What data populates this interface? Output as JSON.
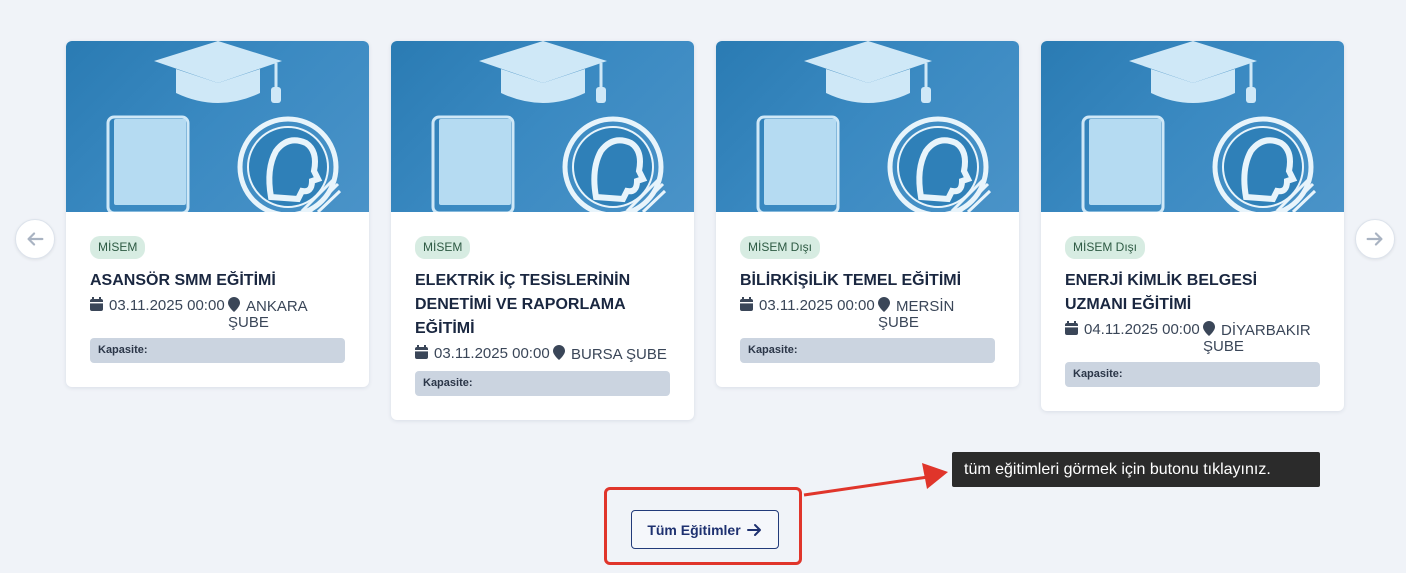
{
  "carousel": {
    "cards": [
      {
        "badge": "MİSEM",
        "title": "ASANSÖR SMM EĞİTİMİ",
        "date": "03.11.2025 00:00",
        "location": "ANKARA ŞUBE",
        "capacity_label": "Kapasite:"
      },
      {
        "badge": "MİSEM",
        "title": "ELEKTRİK İÇ TESİSLERİNİN DENETİMİ VE RAPORLAMA EĞİTİMİ",
        "date": "03.11.2025 00:00",
        "location": "BURSA ŞUBE",
        "capacity_label": "Kapasite:"
      },
      {
        "badge": "MİSEM Dışı",
        "title": "BİLİRKİŞİLİK TEMEL EĞİTİMİ",
        "date": "03.11.2025 00:00",
        "location": "MERSİN ŞUBE",
        "capacity_label": "Kapasite:"
      },
      {
        "badge": "MİSEM Dışı",
        "title": "ENERJİ KİMLİK BELGESİ UZMANI EĞİTİMİ",
        "date": "04.11.2025 00:00",
        "location": "DİYARBAKIR ŞUBE",
        "capacity_label": "Kapasite:"
      }
    ],
    "prev_icon": "arrow-left-icon",
    "next_icon": "arrow-right-icon"
  },
  "all_courses_button": {
    "label": "Tüm Eğitimler",
    "icon": "arrow-right-icon"
  },
  "annotation": {
    "tooltip_text": "tüm eğitimleri görmek için butonu tıklayınız.",
    "highlight_color": "#e0352b"
  },
  "colors": {
    "background": "#f0f3f8",
    "card_image": "#2a7bb3",
    "badge_bg": "#d7ece2",
    "capacity_bg": "#cbd4e0",
    "button_border": "#223b7a"
  }
}
